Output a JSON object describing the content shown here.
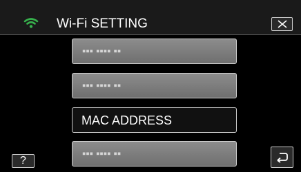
{
  "header": {
    "title": "Wi-Fi SETTING",
    "wifi_icon": "wifi-icon",
    "close_icon": "close-icon"
  },
  "menu": {
    "items": [
      {
        "label": "▪▪▪ ▪▪▪▪ ▪▪",
        "masked": true
      },
      {
        "label": "▪▪▪ ▪▪▪▪ ▪▪",
        "masked": true
      },
      {
        "label": "MAC ADDRESS",
        "masked": false
      },
      {
        "label": "▪▪▪ ▪▪▪▪ ▪▪",
        "masked": true
      }
    ]
  },
  "footer": {
    "help_label": "?",
    "back_icon": "back-icon"
  },
  "colors": {
    "wifi_icon": "#37b24d",
    "button_fill": "#7d7d7d",
    "selected_fill": "#111111"
  }
}
